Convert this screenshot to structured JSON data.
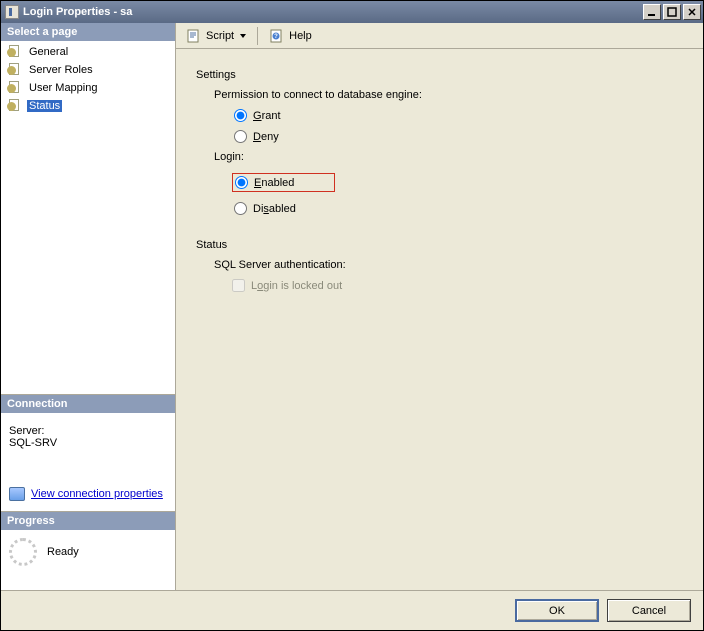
{
  "window": {
    "title": "Login Properties - sa"
  },
  "toolbar": {
    "script_label": "Script",
    "help_label": "Help"
  },
  "sidebar": {
    "select_page_header": "Select a page",
    "items": [
      {
        "label": "General"
      },
      {
        "label": "Server Roles"
      },
      {
        "label": "User Mapping"
      },
      {
        "label": "Status"
      }
    ],
    "selected_index": 3,
    "connection_header": "Connection",
    "server_label": "Server:",
    "server_value": "SQL-SRV",
    "view_connection_link": "View connection properties",
    "progress_header": "Progress",
    "progress_status": "Ready"
  },
  "form": {
    "settings_label": "Settings",
    "permission_label": "Permission to connect to database engine:",
    "permission_options": {
      "grant": "Grant",
      "deny": "Deny"
    },
    "permission_selected": "grant",
    "login_label": "Login:",
    "login_options": {
      "enabled": "Enabled",
      "disabled": "Disabled"
    },
    "login_selected": "enabled",
    "status_label": "Status",
    "sql_auth_label": "SQL Server authentication:",
    "locked_out_label": "Login is locked out",
    "locked_out_checked": false,
    "locked_out_enabled": false
  },
  "buttons": {
    "ok": "OK",
    "cancel": "Cancel"
  }
}
